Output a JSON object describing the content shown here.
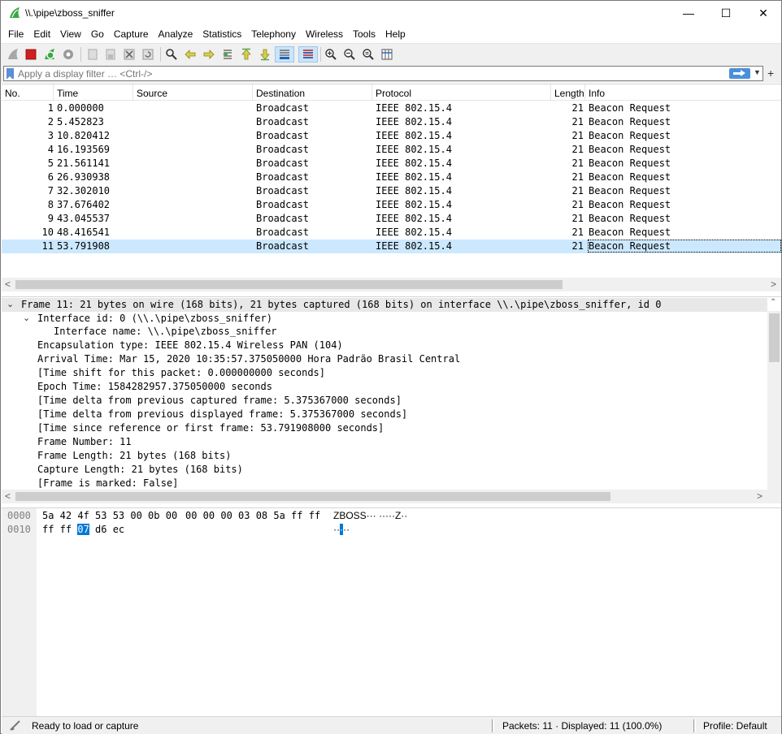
{
  "window": {
    "title": "\\\\.\\pipe\\zboss_sniffer",
    "minimize_glyph": "—",
    "maximize_glyph": "☐",
    "close_glyph": "✕"
  },
  "menu": [
    "File",
    "Edit",
    "View",
    "Go",
    "Capture",
    "Analyze",
    "Statistics",
    "Telephony",
    "Wireless",
    "Tools",
    "Help"
  ],
  "toolbar": {
    "icons": [
      "shark-fin-start-icon",
      "stop-capture-icon",
      "restart-capture-icon",
      "capture-options-icon",
      "open-file-icon",
      "save-file-icon",
      "close-file-icon",
      "reload-file-icon",
      "find-packet-icon",
      "go-back-icon",
      "go-forward-icon",
      "go-to-packet-icon",
      "go-first-icon",
      "go-last-icon",
      "auto-scroll-icon",
      "colorize-icon",
      "zoom-in-icon",
      "zoom-out-icon",
      "normal-size-icon",
      "resize-columns-icon"
    ]
  },
  "filter": {
    "placeholder": "Apply a display filter … <Ctrl-/>",
    "value": ""
  },
  "packet_list": {
    "columns": [
      "No.",
      "Time",
      "Source",
      "Destination",
      "Protocol",
      "Length",
      "Info"
    ],
    "rows": [
      {
        "no": "1",
        "time": "0.000000",
        "source": "",
        "destination": "Broadcast",
        "protocol": "IEEE 802.15.4",
        "length": "21",
        "info": "Beacon Request"
      },
      {
        "no": "2",
        "time": "5.452823",
        "source": "",
        "destination": "Broadcast",
        "protocol": "IEEE 802.15.4",
        "length": "21",
        "info": "Beacon Request"
      },
      {
        "no": "3",
        "time": "10.820412",
        "source": "",
        "destination": "Broadcast",
        "protocol": "IEEE 802.15.4",
        "length": "21",
        "info": "Beacon Request"
      },
      {
        "no": "4",
        "time": "16.193569",
        "source": "",
        "destination": "Broadcast",
        "protocol": "IEEE 802.15.4",
        "length": "21",
        "info": "Beacon Request"
      },
      {
        "no": "5",
        "time": "21.561141",
        "source": "",
        "destination": "Broadcast",
        "protocol": "IEEE 802.15.4",
        "length": "21",
        "info": "Beacon Request"
      },
      {
        "no": "6",
        "time": "26.930938",
        "source": "",
        "destination": "Broadcast",
        "protocol": "IEEE 802.15.4",
        "length": "21",
        "info": "Beacon Request"
      },
      {
        "no": "7",
        "time": "32.302010",
        "source": "",
        "destination": "Broadcast",
        "protocol": "IEEE 802.15.4",
        "length": "21",
        "info": "Beacon Request"
      },
      {
        "no": "8",
        "time": "37.676402",
        "source": "",
        "destination": "Broadcast",
        "protocol": "IEEE 802.15.4",
        "length": "21",
        "info": "Beacon Request"
      },
      {
        "no": "9",
        "time": "43.045537",
        "source": "",
        "destination": "Broadcast",
        "protocol": "IEEE 802.15.4",
        "length": "21",
        "info": "Beacon Request"
      },
      {
        "no": "10",
        "time": "48.416541",
        "source": "",
        "destination": "Broadcast",
        "protocol": "IEEE 802.15.4",
        "length": "21",
        "info": "Beacon Request"
      },
      {
        "no": "11",
        "time": "53.791908",
        "source": "",
        "destination": "Broadcast",
        "protocol": "IEEE 802.15.4",
        "length": "21",
        "info": "Beacon Request"
      }
    ],
    "selected_row": "11"
  },
  "details": {
    "lines": [
      "Frame 11: 21 bytes on wire (168 bits), 21 bytes captured (168 bits) on interface \\\\.\\pipe\\zboss_sniffer, id 0",
      "Interface id: 0 (\\\\.\\pipe\\zboss_sniffer)",
      "Interface name: \\\\.\\pipe\\zboss_sniffer",
      "Encapsulation type: IEEE 802.15.4 Wireless PAN (104)",
      "Arrival Time: Mar 15, 2020 10:35:57.375050000 Hora Padrão Brasil Central",
      "[Time shift for this packet: 0.000000000 seconds]",
      "Epoch Time: 1584282957.375050000 seconds",
      "[Time delta from previous captured frame: 5.375367000 seconds]",
      "[Time delta from previous displayed frame: 5.375367000 seconds]",
      "[Time since reference or first frame: 53.791908000 seconds]",
      "Frame Number: 11",
      "Frame Length: 21 bytes (168 bits)",
      "Capture Length: 21 bytes (168 bits)",
      "[Frame is marked: False]"
    ]
  },
  "bytes": {
    "lines": [
      {
        "offset": "0000",
        "hex1": "5a 42 4f 53 53 00 0b 00",
        "hex2": "00 00 00 03 08 5a ff ff",
        "ascii": "ZBOSS··· ·····Z··"
      },
      {
        "offset": "0010",
        "hex_pre": "ff ff ",
        "hex_hl": "07",
        "hex_post": " d6 ec",
        "ascii_pre": "··",
        "ascii_hl": "·",
        "ascii_post": "··"
      }
    ]
  },
  "status": {
    "ready": "Ready to load or capture",
    "packets": "Packets: 11 · Displayed: 11 (100.0%)",
    "profile": "Profile: Default"
  },
  "colors": {
    "selected_row": "#cce8ff",
    "highlight": "#0078d7",
    "accent_green": "#3aa845"
  }
}
